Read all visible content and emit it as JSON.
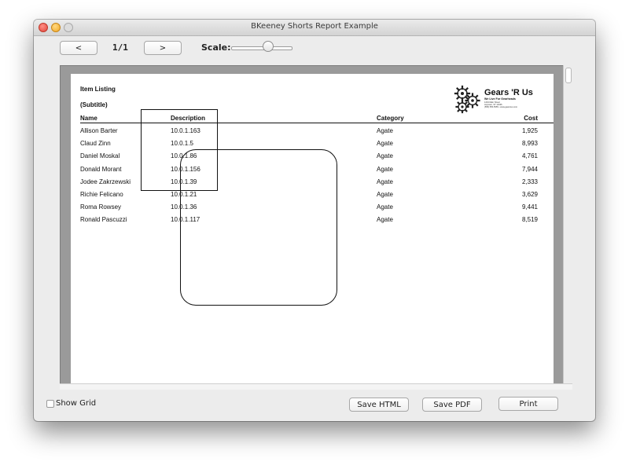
{
  "window": {
    "title": "BKeeney Shorts Report Example"
  },
  "toolbar": {
    "prev_label": "<",
    "page_counter": "1/1",
    "next_label": ">",
    "scale_label": "Scale:",
    "scale_value": 0.5
  },
  "report": {
    "title": "Item Listing",
    "subtitle": "(Subtitle)",
    "columns": [
      "Name",
      "Description",
      "Category",
      "Cost"
    ],
    "rows": [
      [
        "Allison Barter",
        "10.0.1.163",
        "Agate",
        "1,925"
      ],
      [
        "Claud Zinn",
        "10.0.1.5",
        "Agate",
        "8,993"
      ],
      [
        "Daniel Moskal",
        "10.0.1.86",
        "Agate",
        "4,761"
      ],
      [
        "Donald Morant",
        "10.0.1.156",
        "Agate",
        "7,944"
      ],
      [
        "Jodee Zakrzewski",
        "10.0.1.39",
        "Agate",
        "2,333"
      ],
      [
        "Richie Felicano",
        "10.0.1.21",
        "Agate",
        "3,629"
      ],
      [
        "Roma Rowsey",
        "10.0.1.36",
        "Agate",
        "9,441"
      ],
      [
        "Ronald Pascuzzi",
        "10.0.1.117",
        "Agate",
        "8,519"
      ]
    ],
    "logo": {
      "name": "Gears 'R Us",
      "tagline": "We Live For Gearheads",
      "address_1": "1234 Main Street",
      "address_2": "Anytown, ST 12345",
      "contact": "(555) 555-5555 • www.gearsrus.com"
    }
  },
  "footer": {
    "show_grid_label": "Show Grid",
    "show_grid_checked": false,
    "save_html_label": "Save HTML",
    "save_pdf_label": "Save PDF",
    "print_label": "Print"
  },
  "colors": {
    "window_bg": "#ececec",
    "scroll_bg": "#9a9a9a",
    "page_bg": "#ffffff",
    "close_button": "#e0443b",
    "minimize_button": "#f2a824"
  },
  "icons": [
    "close-icon",
    "minimize-icon",
    "zoom-icon",
    "gear-logo-icon"
  ]
}
